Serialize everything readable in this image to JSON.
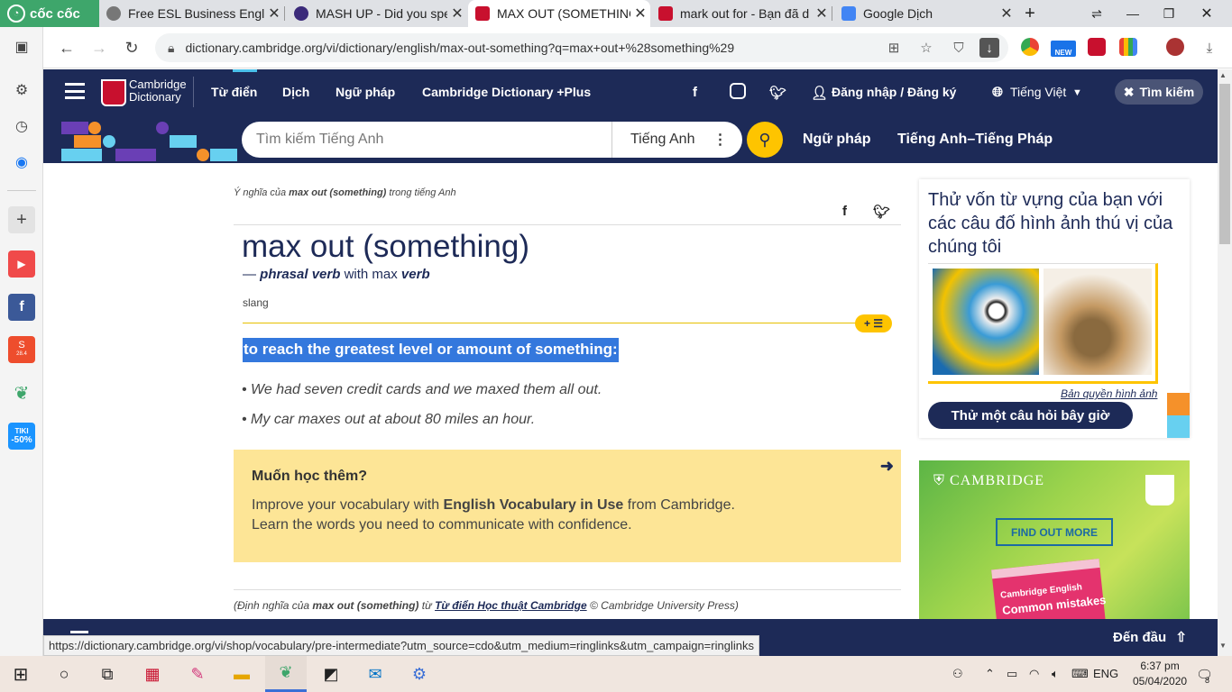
{
  "browser": {
    "brand": "cốc cốc",
    "tabs": [
      {
        "title": "Free ESL Business Englis",
        "active": false,
        "fav_color": "#777"
      },
      {
        "title": "MASH UP - Did you spe",
        "active": false,
        "fav_color": "#3b2a7a"
      },
      {
        "title": "MAX OUT (SOMETHING",
        "active": true,
        "fav_color": "#c8102e"
      },
      {
        "title": "mark out for - Bạn đã d",
        "active": false,
        "fav_color": "#c8102e"
      },
      {
        "title": "Google Dịch",
        "active": false,
        "fav_color": "#4285f4"
      }
    ],
    "url": "dictionary.cambridge.org/vi/dictionary/english/max-out-something?q=max+out+%28something%29",
    "status_url": "https://dictionary.cambridge.org/vi/shop/vocabulary/pre-intermediate?utm_source=cdo&utm_medium=ringlinks&utm_campaign=ringlinks",
    "new_badge": "NEW",
    "sidebar_badges": {
      "shopee": "28.4",
      "tiki_top": "TIKI",
      "tiki_bottom": "-50%"
    }
  },
  "header": {
    "logo_line1": "Cambridge",
    "logo_line2": "Dictionary",
    "nav": [
      "Từ điển",
      "Dịch",
      "Ngữ pháp",
      "Cambridge Dictionary +Plus"
    ],
    "login": "Đăng nhập / Đăng ký",
    "language": "Tiếng Việt",
    "search_label": "Tìm kiếm",
    "search_placeholder": "Tìm kiếm Tiếng Anh",
    "search_lang": "Tiếng Anh",
    "sub_links": [
      "Ngữ pháp",
      "Tiếng Anh–Tiếng Pháp"
    ]
  },
  "entry": {
    "crumb_pre": "Ý nghĩa của",
    "crumb_word": "max out (something)",
    "crumb_post": "trong tiếng Anh",
    "headword": "max out (something)",
    "pos_dash": "—",
    "pos": "phrasal verb",
    "pos_with": "with max",
    "pos_verb": "verb",
    "usage": "slang",
    "definition": "to reach the greatest level or amount of something:",
    "examples": [
      "We had seven credit cards and we maxed them all out.",
      "My car maxes out at about 80 miles an hour."
    ],
    "learn_heading": "Muốn học thêm?",
    "learn_l1_pre": "Improve your vocabulary with",
    "learn_l1_bold": "English Vocabulary in Use",
    "learn_l1_post": "from Cambridge.",
    "learn_l2": "Learn the words you need to communicate with confidence.",
    "source_pre": "(Định nghĩa của",
    "source_word": "max out (something)",
    "source_mid": "từ",
    "source_link": "Từ điển Học thuật Cambridge",
    "source_post": "© Cambridge University Press)"
  },
  "quiz": {
    "title": "Thử vốn từ vựng của bạn với các câu đố hình ảnh thú vị của chúng tôi",
    "copyright": "Bản quyền hình ảnh",
    "button": "Thử một câu hỏi bây giờ"
  },
  "ad": {
    "brand": "CAMBRIDGE",
    "cta": "FIND OUT MORE",
    "book_series": "Cambridge English",
    "book_title": "Common mistakes"
  },
  "footer": {
    "back_to_top": "Đến đầu"
  },
  "taskbar": {
    "lang": "ENG",
    "time": "6:37 pm",
    "date": "05/04/2020",
    "notifications": "8"
  }
}
